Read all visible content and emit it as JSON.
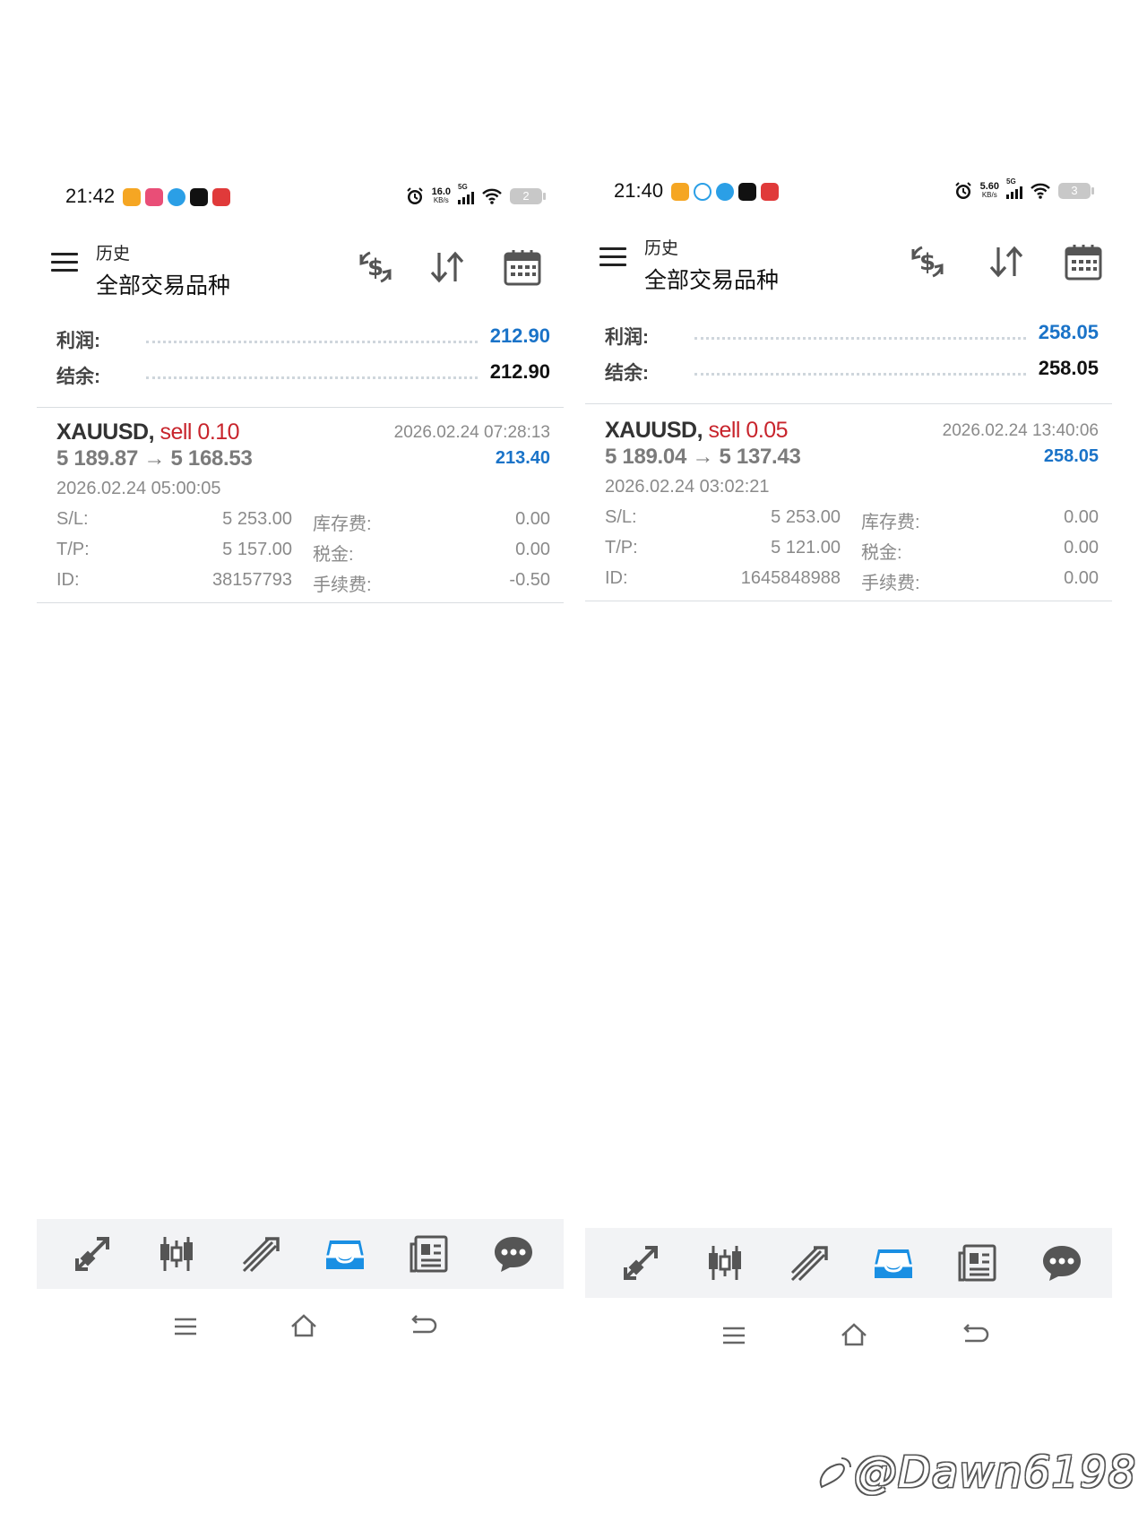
{
  "phones": [
    {
      "status": {
        "time": "21:42",
        "net_speed": "16.0",
        "net_unit": "KB/s",
        "net_type": "5G",
        "battery": "2"
      },
      "header": {
        "subtitle": "历史",
        "title": "全部交易品种"
      },
      "summary": {
        "profit_label": "利润:",
        "profit_value": "212.90",
        "balance_label": "结余:",
        "balance_value": "212.90"
      },
      "deal": {
        "symbol": "XAUUSD,",
        "side": "sell 0.10",
        "open_price": "5 189.87",
        "arrow": "→",
        "close_price": "5 168.53",
        "close_time": "2026.02.24 07:28:13",
        "profit": "213.40",
        "open_time": "2026.02.24 05:00:05",
        "sl_label": "S/L:",
        "sl_value": "5 253.00",
        "swap_label": "库存费:",
        "swap_value": "0.00",
        "tp_label": "T/P:",
        "tp_value": "5 157.00",
        "tax_label": "税金:",
        "tax_value": "0.00",
        "id_label": "ID:",
        "id_value": "38157793",
        "fee_label": "手续费:",
        "fee_value": "-0.50"
      }
    },
    {
      "status": {
        "time": "21:40",
        "net_speed": "5.60",
        "net_unit": "KB/s",
        "net_type": "5G",
        "battery": "3"
      },
      "header": {
        "subtitle": "历史",
        "title": "全部交易品种"
      },
      "summary": {
        "profit_label": "利润:",
        "profit_value": "258.05",
        "balance_label": "结余:",
        "balance_value": "258.05"
      },
      "deal": {
        "symbol": "XAUUSD,",
        "side": "sell 0.05",
        "open_price": "5 189.04",
        "arrow": "→",
        "close_price": "5 137.43",
        "close_time": "2026.02.24 13:40:06",
        "profit": "258.05",
        "open_time": "2026.02.24 03:02:21",
        "sl_label": "S/L:",
        "sl_value": "5 253.00",
        "swap_label": "库存费:",
        "swap_value": "0.00",
        "tp_label": "T/P:",
        "tp_value": "5 121.00",
        "tax_label": "税金:",
        "tax_value": "0.00",
        "id_label": "ID:",
        "id_value": "1645848988",
        "fee_label": "手续费:",
        "fee_value": "0.00"
      }
    }
  ],
  "icons": {
    "toolbar": [
      "currency-exchange-icon",
      "sort-icon",
      "calendar-icon"
    ],
    "bottom_nav": [
      "quotes-icon",
      "chart-icon",
      "trade-icon",
      "history-icon",
      "news-icon",
      "chat-icon"
    ],
    "system_nav": [
      "recents-icon",
      "home-icon",
      "back-icon"
    ]
  },
  "colors": {
    "accent": "#1a73c8",
    "sell": "#c8242c",
    "nav_active": "#1a8fe3",
    "nav_inactive": "#555555"
  },
  "watermark": "@Dawn6198"
}
